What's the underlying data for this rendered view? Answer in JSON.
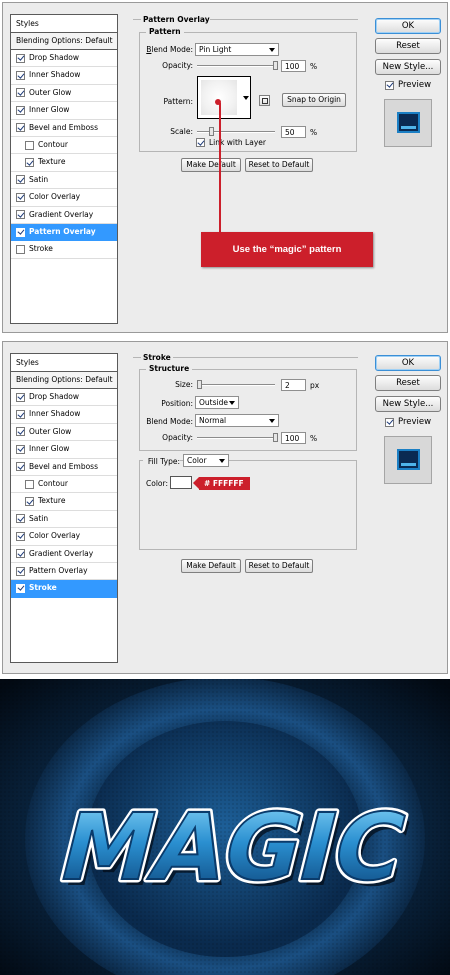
{
  "panel1": {
    "styles_header": "Styles",
    "blending_options": "Blending Options: Default",
    "items": [
      {
        "label": "Drop Shadow",
        "checked": true,
        "indent": false,
        "selected": false
      },
      {
        "label": "Inner Shadow",
        "checked": true,
        "indent": false,
        "selected": false
      },
      {
        "label": "Outer Glow",
        "checked": true,
        "indent": false,
        "selected": false
      },
      {
        "label": "Inner Glow",
        "checked": true,
        "indent": false,
        "selected": false
      },
      {
        "label": "Bevel and Emboss",
        "checked": true,
        "indent": false,
        "selected": false
      },
      {
        "label": "Contour",
        "checked": false,
        "indent": true,
        "selected": false
      },
      {
        "label": "Texture",
        "checked": true,
        "indent": true,
        "selected": false
      },
      {
        "label": "Satin",
        "checked": true,
        "indent": false,
        "selected": false
      },
      {
        "label": "Color Overlay",
        "checked": true,
        "indent": false,
        "selected": false
      },
      {
        "label": "Gradient Overlay",
        "checked": true,
        "indent": false,
        "selected": false
      },
      {
        "label": "Pattern Overlay",
        "checked": true,
        "indent": false,
        "selected": true
      },
      {
        "label": "Stroke",
        "checked": false,
        "indent": false,
        "selected": false
      }
    ],
    "section_title": "Pattern Overlay",
    "group_title": "Pattern",
    "blend_mode_label": "Blend Mode:",
    "blend_mode_value": "Pin Light",
    "opacity_label": "Opacity:",
    "opacity_value": "100",
    "opacity_fraction": 1.0,
    "pattern_label": "Pattern:",
    "snap_button": "Snap to Origin",
    "scale_label": "Scale:",
    "scale_value": "50",
    "scale_fraction": 0.5,
    "link_label": "Link with Layer",
    "link_checked": true,
    "percent": "%",
    "make_default": "Make Default",
    "reset_default": "Reset to Default",
    "callout": "Use the “magic” pattern"
  },
  "panel2": {
    "styles_header": "Styles",
    "blending_options": "Blending Options: Default",
    "items": [
      {
        "label": "Drop Shadow",
        "checked": true,
        "indent": false,
        "selected": false
      },
      {
        "label": "Inner Shadow",
        "checked": true,
        "indent": false,
        "selected": false
      },
      {
        "label": "Outer Glow",
        "checked": true,
        "indent": false,
        "selected": false
      },
      {
        "label": "Inner Glow",
        "checked": true,
        "indent": false,
        "selected": false
      },
      {
        "label": "Bevel and Emboss",
        "checked": true,
        "indent": false,
        "selected": false
      },
      {
        "label": "Contour",
        "checked": false,
        "indent": true,
        "selected": false
      },
      {
        "label": "Texture",
        "checked": true,
        "indent": true,
        "selected": false
      },
      {
        "label": "Satin",
        "checked": true,
        "indent": false,
        "selected": false
      },
      {
        "label": "Color Overlay",
        "checked": true,
        "indent": false,
        "selected": false
      },
      {
        "label": "Gradient Overlay",
        "checked": true,
        "indent": false,
        "selected": false
      },
      {
        "label": "Pattern Overlay",
        "checked": true,
        "indent": false,
        "selected": false
      },
      {
        "label": "Stroke",
        "checked": true,
        "indent": false,
        "selected": true
      }
    ],
    "section_title": "Stroke",
    "group_title": "Structure",
    "size_label": "Size:",
    "size_value": "2",
    "size_fraction": 0.02,
    "size_unit": "px",
    "position_label": "Position:",
    "position_value": "Outside",
    "blend_mode_label": "Blend Mode:",
    "blend_mode_value": "Normal",
    "opacity_label": "Opacity:",
    "opacity_value": "100",
    "opacity_fraction": 1.0,
    "percent": "%",
    "fill_type_label": "Fill Type:",
    "fill_type_value": "Color",
    "color_label": "Color:",
    "color_swatch": "#FFFFFF",
    "color_hex_tag": "# FFFFFF",
    "make_default": "Make Default",
    "reset_default": "Reset to Default"
  },
  "buttons": {
    "ok": "OK",
    "reset": "Reset",
    "new_style": "New Style...",
    "preview": "Preview",
    "preview_checked": true
  },
  "artwork": {
    "text": "MAGIC",
    "colors": {
      "background": "#061525",
      "ring": "#0e3e6e",
      "text_fill_top": "#7fd0f6",
      "text_fill_bottom": "#0a4d86",
      "text_stroke": "#ffffff"
    }
  },
  "accent": {
    "selection": "#3399ff",
    "callout": "#cc1f2b"
  }
}
